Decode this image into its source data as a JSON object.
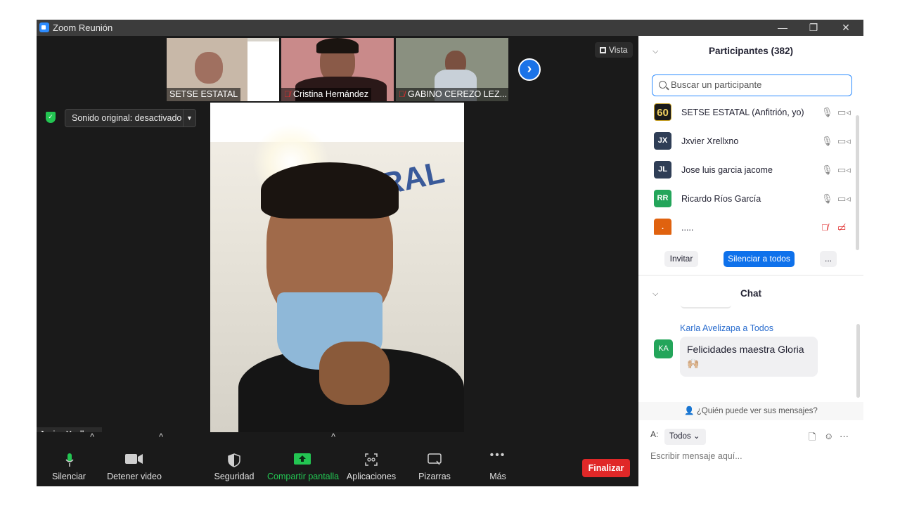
{
  "window": {
    "title": "Zoom Reunión",
    "minimize": "—",
    "restore": "❐",
    "close": "✕"
  },
  "video": {
    "vista_label": "Vista",
    "thumbs": [
      {
        "name": "SETSE ESTATAL",
        "muted": false
      },
      {
        "name": "Cristina Hernández",
        "muted": true
      },
      {
        "name": "GABINO CEREZO LEZ...",
        "muted": true
      }
    ],
    "sound_label": "Sonido original: desactivado",
    "active_speaker": "Jxvier Xrellxno",
    "wall_text": "RURAL"
  },
  "toolbar": {
    "mute": "Silenciar",
    "video": "Detener video",
    "security": "Seguridad",
    "share": "Compartir pantalla",
    "apps": "Aplicaciones",
    "whiteboards": "Pizarras",
    "more": "Más",
    "end": "Finalizar"
  },
  "participants": {
    "header": "Participantes (382)",
    "search_placeholder": "Buscar un participante",
    "list": [
      {
        "initials": "60",
        "name": "SETSE ESTATAL (Anfitrión, yo)",
        "color": "#1a1a1a",
        "mic_muted": false,
        "cam_off": false
      },
      {
        "initials": "JX",
        "name": "Jxvier Xrellxno",
        "color": "#2f3e56",
        "mic_muted": false,
        "cam_off": false
      },
      {
        "initials": "JL",
        "name": "Jose luis garcia jacome",
        "color": "#2f3e56",
        "mic_muted": false,
        "cam_off": false
      },
      {
        "initials": "RR",
        "name": "Ricardo Ríos García",
        "color": "#23a55a",
        "mic_muted": false,
        "cam_off": false
      },
      {
        "initials": ".",
        "name": ".....",
        "color": "#e0620f",
        "mic_muted": true,
        "cam_off": true
      }
    ],
    "invite": "Invitar",
    "mute_all": "Silenciar a todos",
    "more": "..."
  },
  "chat": {
    "header": "Chat",
    "sender": "Karla Avelizapa a Todos",
    "sender_initials": "KA",
    "message": "Felicidades maestra Gloria",
    "message_emoji": "🙌🏼",
    "who_can_see": "¿Quién puede ver sus mensajes?",
    "to_label": "A:",
    "to_value": "Todos",
    "input_placeholder": "Escribir mensaje aquí..."
  }
}
